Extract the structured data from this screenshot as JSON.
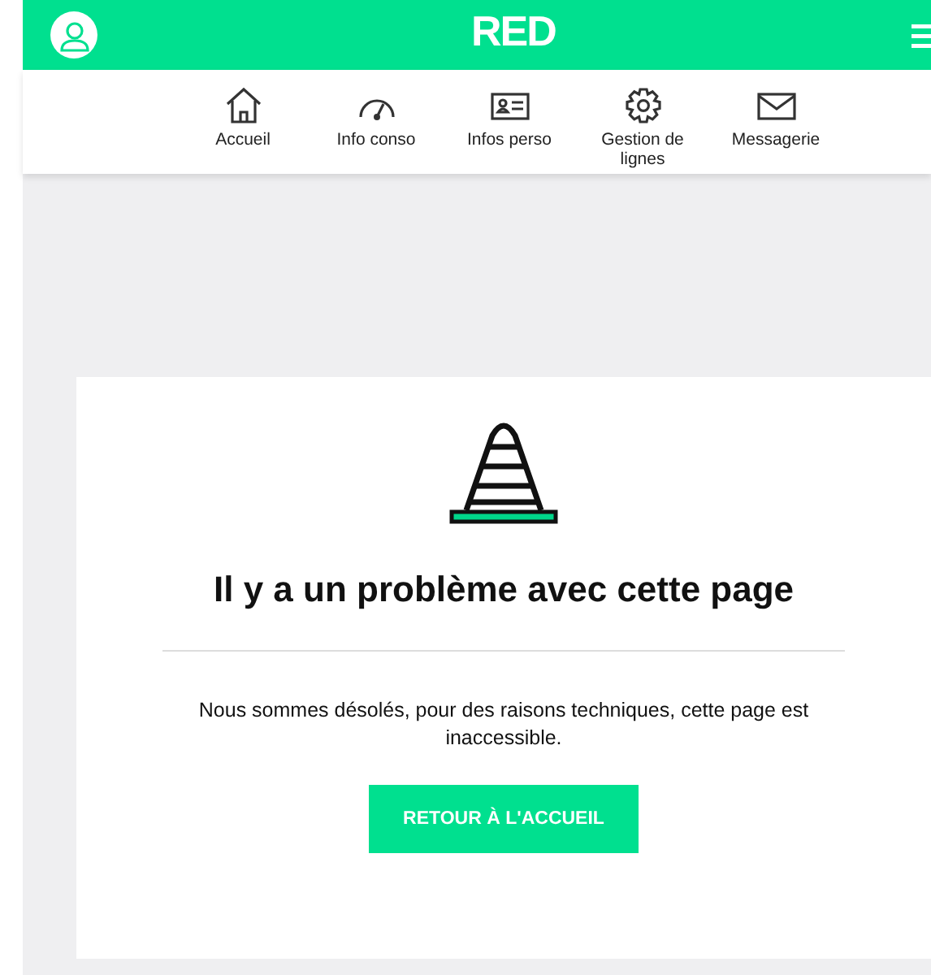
{
  "header": {
    "logo": "RED"
  },
  "nav": [
    {
      "label": "Accueil",
      "kind": "home"
    },
    {
      "label": "Info conso",
      "kind": "gauge"
    },
    {
      "label": "Infos perso",
      "kind": "card"
    },
    {
      "label": "Gestion de lignes",
      "kind": "gear"
    },
    {
      "label": "Messagerie",
      "kind": "mail"
    }
  ],
  "error": {
    "title": "Il y a un problème avec cette page",
    "message": "Nous sommes désolés, pour des raisons techniques, cette page est inaccessible.",
    "button": "RETOUR À L'ACCUEIL"
  }
}
